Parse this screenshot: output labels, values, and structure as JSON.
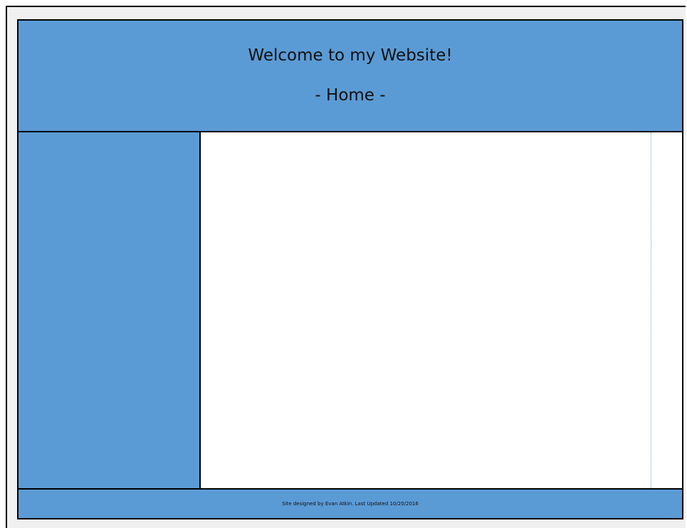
{
  "header": {
    "title": "Welcome to my Website!",
    "subtitle": "- Home -"
  },
  "footer": {
    "text": "Site designed by Evan Atkin. Last Updated 10/20/2016"
  },
  "colors": {
    "accent": "#5b9bd5",
    "content_background": "#ffffff",
    "border": "#000000"
  }
}
